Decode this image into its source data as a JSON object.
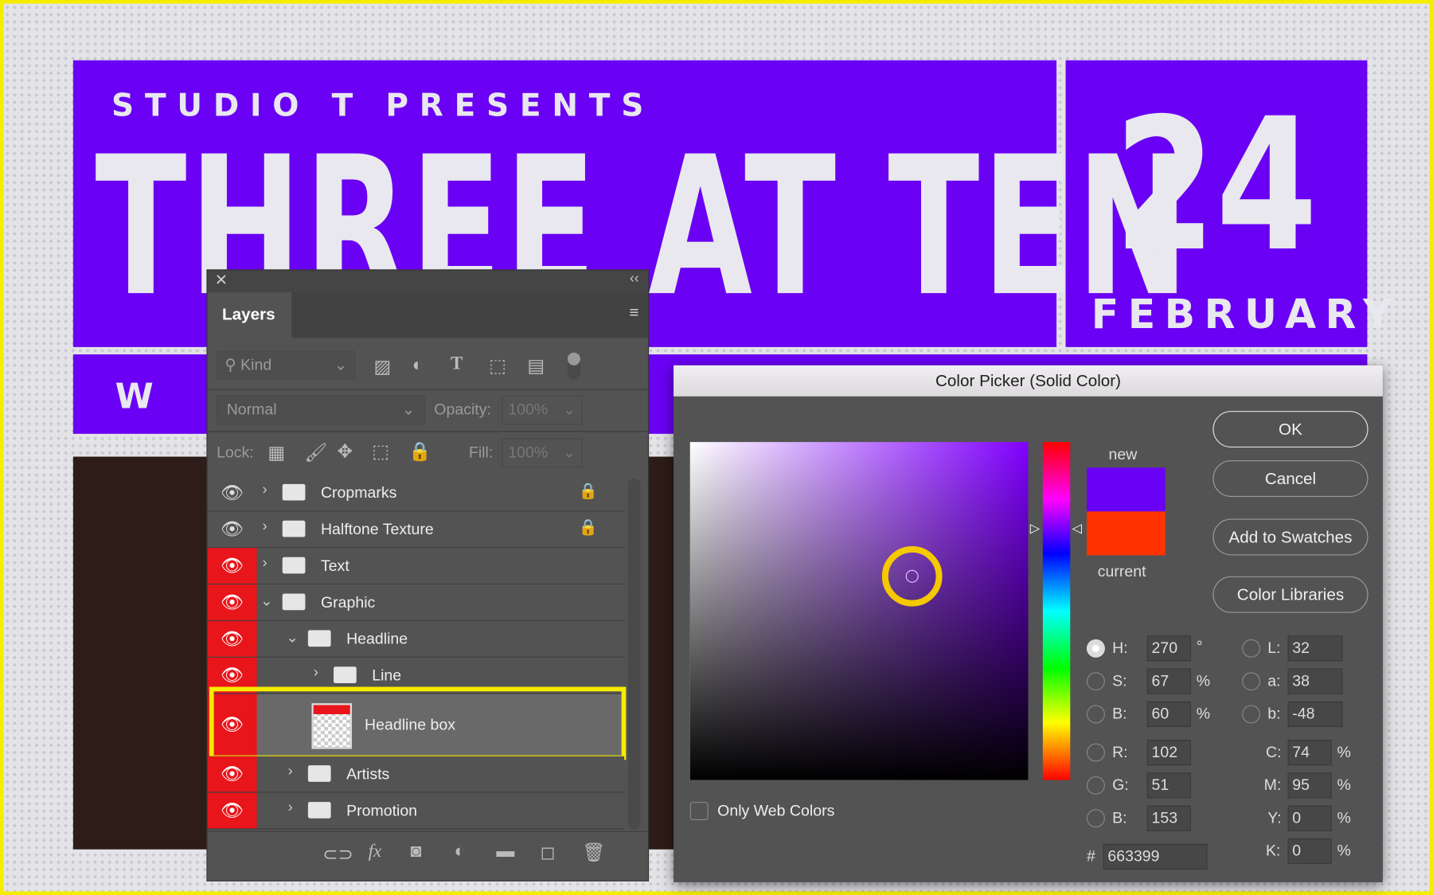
{
  "poster": {
    "presents": "STUDIO T PRESENTS",
    "headline": "THREE AT TEN",
    "day": "24",
    "month": "FEBRUARY",
    "sub": "W I",
    "color": "#6a00f4"
  },
  "layers_panel": {
    "tab": "Layers",
    "filter": {
      "kind_label": "Kind"
    },
    "blend_mode": "Normal",
    "opacity_label": "Opacity:",
    "opacity_value": "100%",
    "lock_label": "Lock:",
    "fill_label": "Fill:",
    "fill_value": "100%",
    "layers": [
      {
        "name": "Cropmarks",
        "locked": true,
        "visible_highlight": false
      },
      {
        "name": "Halftone Texture",
        "locked": true,
        "visible_highlight": false
      },
      {
        "name": "Text",
        "visible_highlight": true
      },
      {
        "name": "Graphic",
        "expanded": true,
        "visible_highlight": true
      },
      {
        "name": "Headline",
        "expanded": true,
        "visible_highlight": true
      },
      {
        "name": "Line",
        "visible_highlight": true
      },
      {
        "name": "Headline box",
        "selected": true,
        "visible_highlight": true
      },
      {
        "name": "Artists",
        "visible_highlight": true
      },
      {
        "name": "Promotion",
        "visible_highlight": true
      }
    ],
    "highlight_color": "#f5ec00"
  },
  "color_picker": {
    "title": "Color Picker (Solid Color)",
    "ok": "OK",
    "cancel": "Cancel",
    "add_to_swatches": "Add to Swatches",
    "color_libraries": "Color Libraries",
    "new_label": "new",
    "current_label": "current",
    "new_color": "#6a00f4",
    "current_color": "#ff3300",
    "only_web_colors": "Only Web Colors",
    "hsb": {
      "H": "270",
      "S": "67",
      "B": "60",
      "h_unit": "°",
      "pct": "%"
    },
    "lab": {
      "L": "32",
      "a": "38",
      "b": "-48"
    },
    "rgb": {
      "R": "102",
      "G": "51",
      "B": "153"
    },
    "cmyk": {
      "C": "74",
      "M": "95",
      "Y": "0",
      "K": "0"
    },
    "hex": "663399",
    "labels": {
      "H": "H:",
      "S": "S:",
      "Bv": "B:",
      "R": "R:",
      "G": "G:",
      "Bb": "B:",
      "L": "L:",
      "a": "a:",
      "b": "b:",
      "C": "C:",
      "M": "M:",
      "Y": "Y:",
      "K": "K:",
      "hash": "#"
    }
  }
}
